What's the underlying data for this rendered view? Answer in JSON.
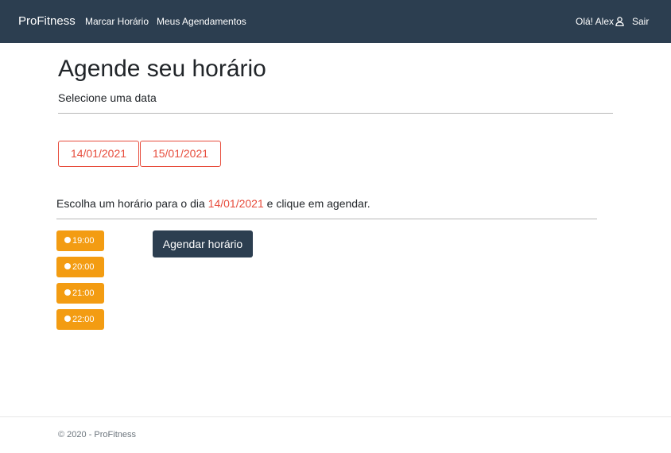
{
  "navbar": {
    "brand": "ProFitness",
    "links": [
      "Marcar Horário",
      "Meus Agendamentos"
    ],
    "greeting": "Olá! Alex",
    "user_icon": "user-icon",
    "logout": "Sair"
  },
  "page": {
    "title": "Agende seu horário",
    "subtitle": "Selecione uma data"
  },
  "dates": [
    "14/01/2021",
    "15/01/2021"
  ],
  "instruction": {
    "prefix": "Escolha um horário para o dia ",
    "date": "14/01/2021",
    "suffix": " e clique em agendar."
  },
  "time_slots": [
    "19:00",
    "20:00",
    "21:00",
    "22:00"
  ],
  "schedule_button": "Agendar horário",
  "footer": "© 2020 - ProFitness",
  "colors": {
    "navbar": "#2c3e50",
    "accent_red": "#e74c3c",
    "slot_orange": "#f39c12",
    "button_dark": "#2c3e50"
  }
}
